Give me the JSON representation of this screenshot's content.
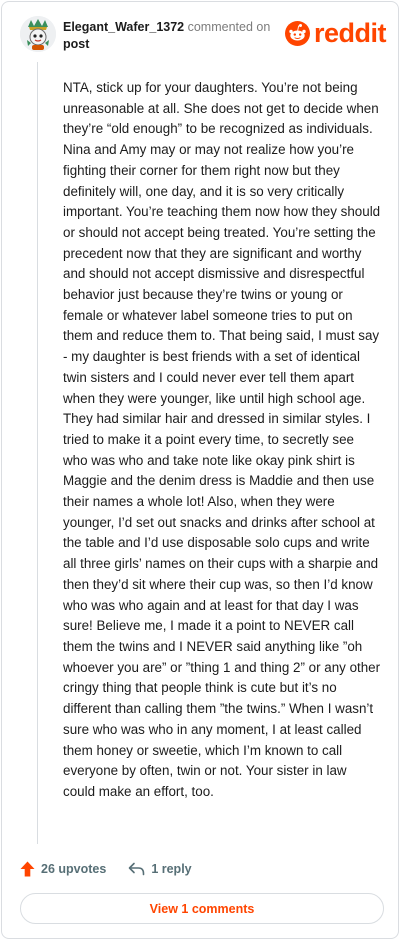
{
  "comment": {
    "username": "Elegant_Wafer_1372",
    "action": "commented on",
    "target": "post",
    "body": "NTA, stick up for your daughters. You’re not being unreasonable at all. She does not get to decide when they’re “old enough” to be recognized as individuals. Nina and Amy may or may not realize how you’re fighting their corner for them right now but they definitely will, one day, and it is so very critically important. You’re teaching them now how they should or should not accept being treated. You’re setting the precedent now that they are significant and worthy and should not accept dismissive and disrespectful behavior just because they’re twins or young or female or whatever label someone tries to put on them and reduce them to. That being said, I must say - my daughter is best friends with a set of identical twin sisters and I could never ever tell them apart when they were younger, like until high school age. They had similar hair and dressed in similar styles. I tried to make it a point every time, to secretly see who was who and take note like okay pink shirt is Maggie and the denim dress is Maddie and then use their names a whole lot! Also, when they were younger, I’d set out snacks and drinks after school at the table and I’d use disposable solo cups and write all three girls’ names on their cups with a sharpie and then they’d sit where their cup was, so then I’d know who was who again and at least for that day I was sure! Believe me, I made it a point to NEVER call them the twins and I NEVER said anything like ”oh whoever you are” or ”thing 1 and thing 2” or any other cringy thing that people think is cute but it’s no different than calling them ”the twins.” When I wasn’t sure who was who in any moment, I at least called them honey or sweetie, which I’m known to call everyone by often, twin or not. Your sister in law could make an effort, too."
  },
  "brand": {
    "name": "reddit",
    "color": "#ff4500",
    "icon": "reddit-snoo-icon"
  },
  "actions": {
    "upvotes_label": "26 upvotes",
    "reply_label": "1 reply",
    "upvote_icon": "upvote-arrow-icon",
    "reply_icon": "reply-arrow-icon"
  },
  "view_comments_label": "View 1 comments",
  "colors": {
    "accent": "#ff4500",
    "muted": "#7c7c7c",
    "action_text": "#576f76"
  }
}
